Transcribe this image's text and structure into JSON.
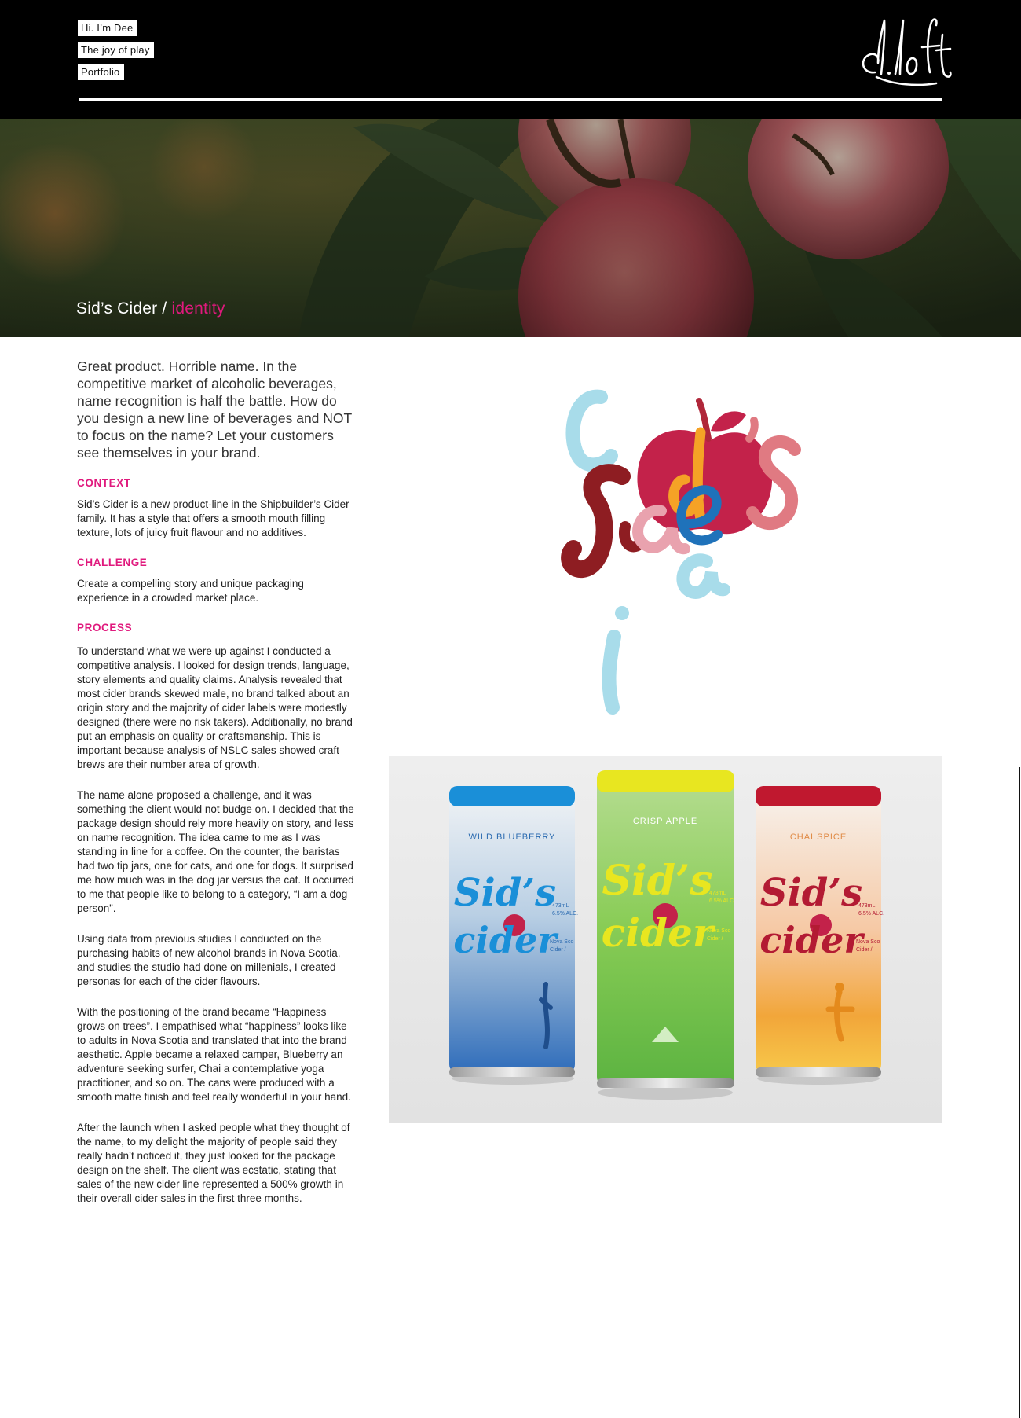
{
  "nav": {
    "items": [
      "Hi. I’m Dee",
      "The joy of play",
      "Portfolio"
    ]
  },
  "logo": {
    "text": "d.loft"
  },
  "hero": {
    "title_main": "Sid’s Cider",
    "title_sep": " / ",
    "title_accent": "identity"
  },
  "content": {
    "lead": "Great product. Horrible name. In the competitive market of alcoholic beverages, name recognition is half the battle. How do you design a new line of beverages and NOT to focus on the name? Let your customers see themselves in your brand.",
    "context_heading": "CONTEXT",
    "context_text": "Sid’s Cider is a new product-line in the Shipbuilder’s Cider family. It has a style that offers a smooth mouth filling texture, lots of juicy fruit flavour and no additives.",
    "challenge_heading": "CHALLENGE",
    "challenge_text": "Create a compelling story and unique packaging experience in a crowded market place.",
    "process_heading": "PROCESS",
    "process_paragraphs": [
      "To understand what we were up against I conducted a competitive analysis. I looked for design trends, language, story elements and quality claims. Analysis revealed that most cider brands skewed male, no brand talked about an origin story and the majority of cider labels were modestly designed (there were no risk takers). Additionally, no brand put an emphasis on quality or craftsmanship. This is important because analysis of NSLC sales showed craft brews are their number area of growth.",
      "The name alone proposed a challenge, and it was something the client would not budge on. I decided that the package design should rely more heavily on story, and less on name recognition. The idea came to me as I was standing in line for a coffee. On the counter, the baristas had two tip jars, one for cats, and one for dogs. It surprised me how much was in the dog jar versus the cat. It occurred to me that people like to belong to a category, “I am a dog person”.",
      "Using data from previous studies I conducted on the purchasing habits of new alcohol brands in Nova Scotia, and studies the studio had done on millenials, I created personas for each of the cider flavours.",
      "With the positioning of the brand became “Happiness grows on trees”. I empathised what “happiness” looks like to adults in Nova Scotia and translated that into the brand aesthetic. Apple became a relaxed camper, Blueberry an adventure seeking surfer, Chai a contemplative yoga practitioner, and so on. The cans were produced with a smooth matte finish and feel really wonderful in your hand.",
      "After the launch when I asked people what they thought of the name, to my delight the majority of people said they really hadn’t noticed it, they just looked for the package design on the shelf. The client was ecstatic, stating that sales of the new cider line represented a 500% growth in their overall cider sales in the first three months."
    ]
  },
  "cans": [
    {
      "flavour": "WILD BLUEBERRY",
      "brand_line1": "Sid’s",
      "brand_line2": "cider",
      "volume": "473mL",
      "abv": "6.5% ALC.",
      "origin": "Nova Sco",
      "product": "Cider /",
      "color": "#1a8fd8"
    },
    {
      "flavour": "CRISP APPLE",
      "brand_line1": "Sid’s",
      "brand_line2": "cider",
      "volume": "473mL",
      "abv": "6.5% ALC.",
      "origin": "Nova Sco",
      "product": "Cider /",
      "color": "#e8e620"
    },
    {
      "flavour": "CHAI SPICE",
      "brand_line1": "Sid’s",
      "brand_line2": "cider",
      "volume": "473mL",
      "abv": "6.5% ALC.",
      "origin": "Nova Sco",
      "product": "Cider /",
      "color": "#c0182f"
    }
  ],
  "colors": {
    "accent": "#e0197d",
    "header_bg": "#000000"
  }
}
